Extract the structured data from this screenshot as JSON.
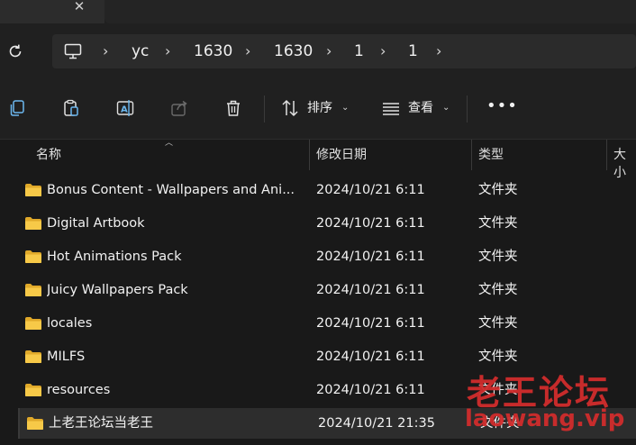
{
  "tabs": {
    "close": "✕",
    "add": "+"
  },
  "address": {
    "crumbs": [
      "yc",
      "1630",
      "1630",
      "1",
      "1"
    ],
    "separator": "›"
  },
  "toolbar": {
    "sort_label": "排序",
    "view_label": "查看",
    "caret": "⌄",
    "more": "•••"
  },
  "columns": {
    "name": "名称",
    "modified": "修改日期",
    "type": "类型",
    "size": "大小"
  },
  "files": [
    {
      "name": "Bonus Content - Wallpapers and Ani...",
      "modified": "2024/10/21 6:11",
      "type": "文件夹"
    },
    {
      "name": "Digital Artbook",
      "modified": "2024/10/21 6:11",
      "type": "文件夹"
    },
    {
      "name": "Hot Animations Pack",
      "modified": "2024/10/21 6:11",
      "type": "文件夹"
    },
    {
      "name": "Juicy Wallpapers Pack",
      "modified": "2024/10/21 6:11",
      "type": "文件夹"
    },
    {
      "name": "locales",
      "modified": "2024/10/21 6:11",
      "type": "文件夹"
    },
    {
      "name": "MILFS",
      "modified": "2024/10/21 6:11",
      "type": "文件夹"
    },
    {
      "name": "resources",
      "modified": "2024/10/21 6:11",
      "type": "文件夹"
    },
    {
      "name": "上老王论坛当老王",
      "modified": "2024/10/21 21:35",
      "type": "文件夹"
    }
  ],
  "watermark": {
    "line1": "老王论坛",
    "line2": "laowang.vip"
  },
  "colors": {
    "folder": "#f7c948",
    "folder_dark": "#e0a92a",
    "accent_icon": "#6cb8f0",
    "watermark": "#d12c2c"
  }
}
